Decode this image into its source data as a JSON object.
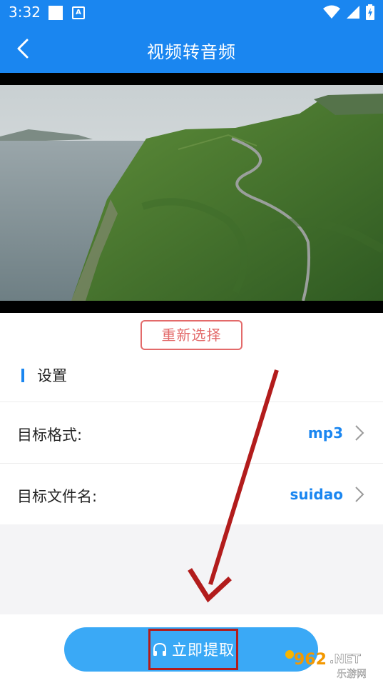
{
  "status_bar": {
    "time": "3:32",
    "notif_icon_letter": "A"
  },
  "app_bar": {
    "title": "视频转音频"
  },
  "buttons": {
    "reselect": "重新选择",
    "extract": "立即提取"
  },
  "settings": {
    "section_title": "设置",
    "rows": [
      {
        "label": "目标格式:",
        "value": "mp3"
      },
      {
        "label": "目标文件名:",
        "value": "suidao"
      }
    ]
  },
  "watermark": {
    "brand_number": "962",
    "brand_suffix": ".NET",
    "brand_name": "乐游网"
  },
  "colors": {
    "primary": "#1a86f0",
    "button": "#3aa9f6",
    "reselect_red": "#e36a6a",
    "annotation_red": "#b21c1c"
  }
}
